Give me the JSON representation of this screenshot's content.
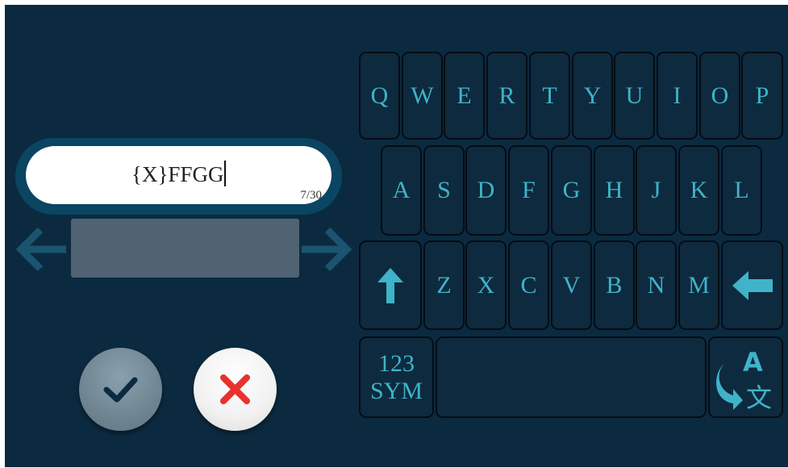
{
  "input": {
    "text": "{X}FFGG",
    "char_count": "7/30"
  },
  "keyboard": {
    "row1": [
      "Q",
      "W",
      "E",
      "R",
      "T",
      "Y",
      "U",
      "I",
      "O",
      "P"
    ],
    "row2": [
      "A",
      "S",
      "D",
      "F",
      "G",
      "H",
      "J",
      "K",
      "L"
    ],
    "row3": [
      "Z",
      "X",
      "C",
      "V",
      "B",
      "N",
      "M"
    ],
    "sym_line1": "123",
    "sym_line2": "SYM",
    "shift_icon": "arrow-up-icon",
    "backspace_icon": "arrow-left-icon",
    "language_icon": "language-translate-icon"
  },
  "icons": {
    "confirm": "checkmark-icon",
    "cancel": "close-icon",
    "prev": "arrow-left-icon",
    "next": "arrow-right-icon"
  },
  "colors": {
    "background": "#0b2a40",
    "key_text": "#3fb3c9",
    "key_fill": "#0e2a3e",
    "cancel_mark": "#e8322f",
    "confirm_mark": "#0b2a40"
  }
}
